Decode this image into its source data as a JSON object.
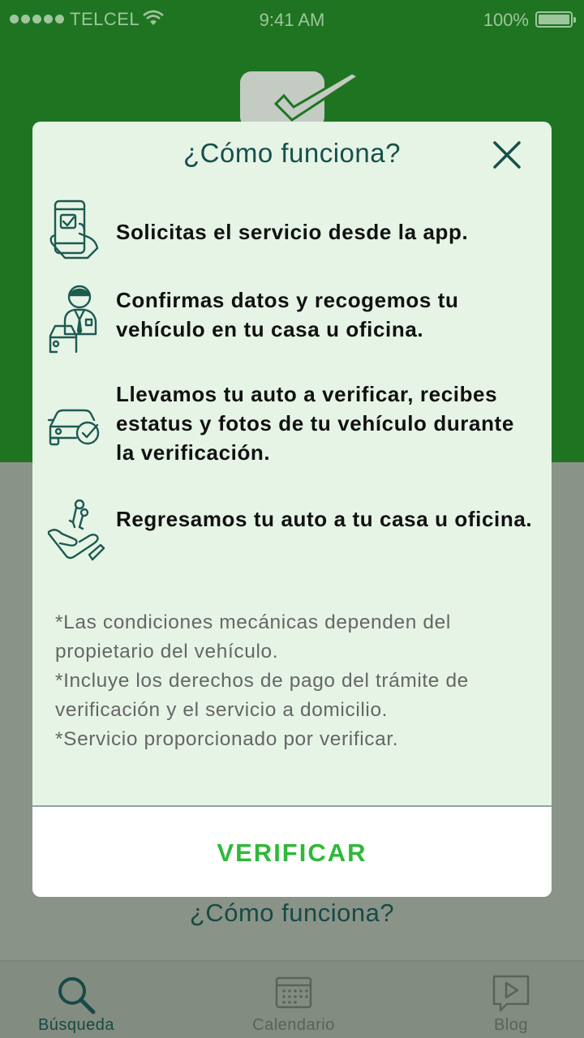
{
  "status_bar": {
    "carrier": "TELCEL",
    "time": "9:41 AM",
    "battery": "100%"
  },
  "background": {
    "how_it_works_link": "¿Cómo funciona?"
  },
  "tabs": [
    {
      "label": "Búsqueda",
      "icon": "search-icon",
      "active": true
    },
    {
      "label": "Calendario",
      "icon": "calendar-icon",
      "active": false
    },
    {
      "label": "Blog",
      "icon": "video-icon",
      "active": false
    }
  ],
  "modal": {
    "title": "¿Cómo funciona?",
    "steps": [
      {
        "icon": "phone-tap-icon",
        "text": "Solicitas el servicio desde la app."
      },
      {
        "icon": "driver-car-icon",
        "text": "Confirmas datos y recogemos tu vehículo en tu casa u oficina."
      },
      {
        "icon": "car-check-icon",
        "text": "Llevamos tu auto a verificar, recibes estatus y fotos de tu vehículo durante la verificación."
      },
      {
        "icon": "hand-keys-icon",
        "text": "Regresamos tu auto a tu casa u oficina."
      }
    ],
    "notes": [
      "*Las condiciones mecánicas dependen del propietario del vehículo.",
      "*Incluye los derechos de pago del trámite de verificación y el servicio a domicilio.",
      "*Servicio proporcionado por verificar."
    ],
    "button_label": "VERIFICAR"
  },
  "colors": {
    "header_green": "#1f7422",
    "modal_bg": "#e6f4e6",
    "title_teal": "#16514a",
    "button_green": "#2fb83a"
  }
}
